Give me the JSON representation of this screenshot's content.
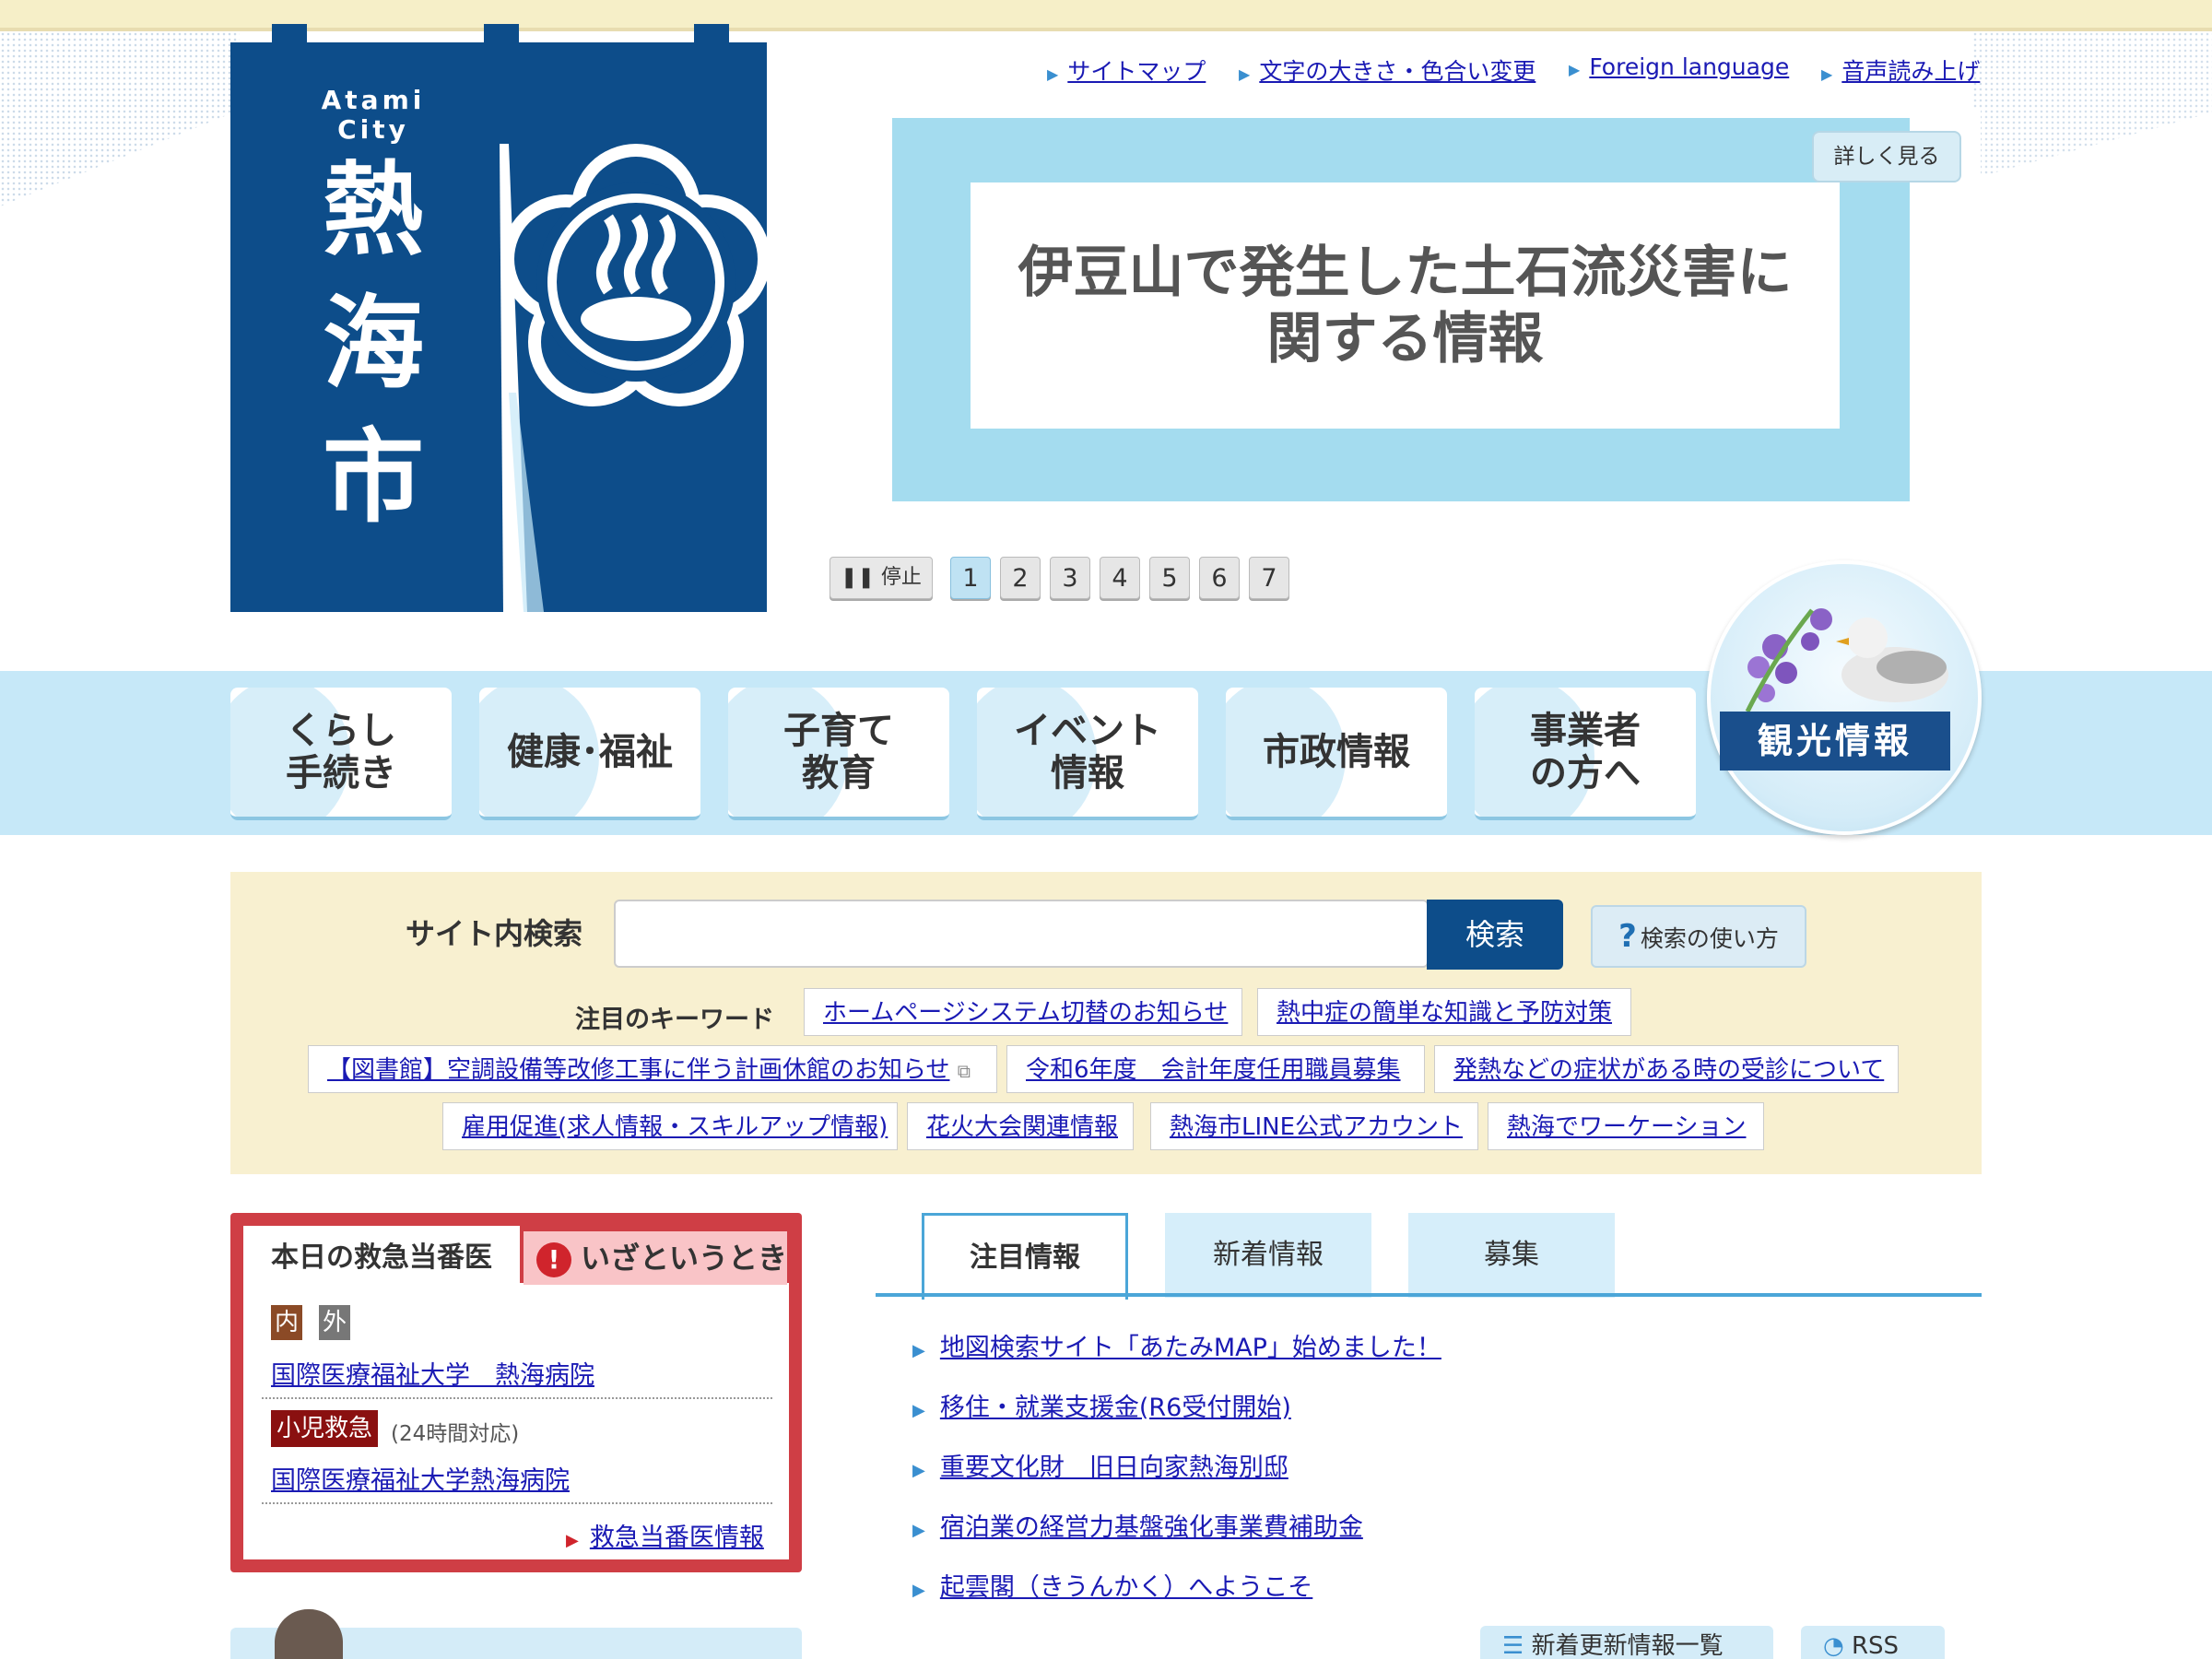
{
  "logo": {
    "latin_line1": "Atami",
    "latin_line2": "City",
    "kanji": [
      "熱",
      "海",
      "市"
    ]
  },
  "util_links": [
    "サイトマップ",
    "文字の大きさ・色合い変更",
    "Foreign language",
    "音声読み上げ"
  ],
  "slider": {
    "headline_line1": "伊豆山で発生した土石流災害に",
    "headline_line2": "関する情報",
    "detail_button": "詳しく見る",
    "stop_label": "停止",
    "pages": [
      "1",
      "2",
      "3",
      "4",
      "5",
      "6",
      "7"
    ],
    "active_page": "1"
  },
  "nav": {
    "items": [
      "くらし\n手続き",
      "健康･福祉",
      "子育て\n教育",
      "イベント\n情報",
      "市政情報",
      "事業者\nの方へ"
    ],
    "tourism": "観光情報"
  },
  "search": {
    "label": "サイト内検索",
    "placeholder": "",
    "button": "検索",
    "help": "検索の使い方",
    "keyword_label": "注目のキーワード",
    "keywords": [
      "ホームページシステム切替のお知らせ",
      "熱中症の簡単な知識と予防対策",
      "【図書館】空調設備等改修工事に伴う計画休館のお知らせ",
      "令和6年度　会計年度任用職員募集",
      "発熱などの症状がある時の受診について",
      "雇用促進(求人情報・スキルアップ情報)",
      "花火大会関連情報",
      "熱海市LINE公式アカウント",
      "熱海でワーケーション"
    ]
  },
  "emergency": {
    "tab_today": "本日の救急当番医",
    "tab_urgent": "いざというとき",
    "tag_internal": "内",
    "tag_external": "外",
    "hospital1": "国際医療福祉大学　熱海病院",
    "pediatric_tag": "小児救急",
    "pediatric_note": "(24時間対応)",
    "hospital2": "国際医療福祉大学熱海病院",
    "more_link": "救急当番医情報"
  },
  "news_tabs": [
    "注目情報",
    "新着情報",
    "募集"
  ],
  "news_items": [
    "地図検索サイト「あたみMAP」始めました！",
    "移住・就業支援金(R6受付開始)",
    "重要文化財　旧日向家熱海別邸",
    "宿泊業の経営力基盤強化事業費補助金",
    "起雲閣（きうんかく）へようこそ"
  ],
  "bottom_buttons": [
    "新着更新情報一覧",
    "RSS"
  ],
  "colors": {
    "navy": "#0d4d8a",
    "light_blue": "#c6e8f8",
    "cream": "#f8f0d0",
    "alert_red": "#cf3e45"
  }
}
